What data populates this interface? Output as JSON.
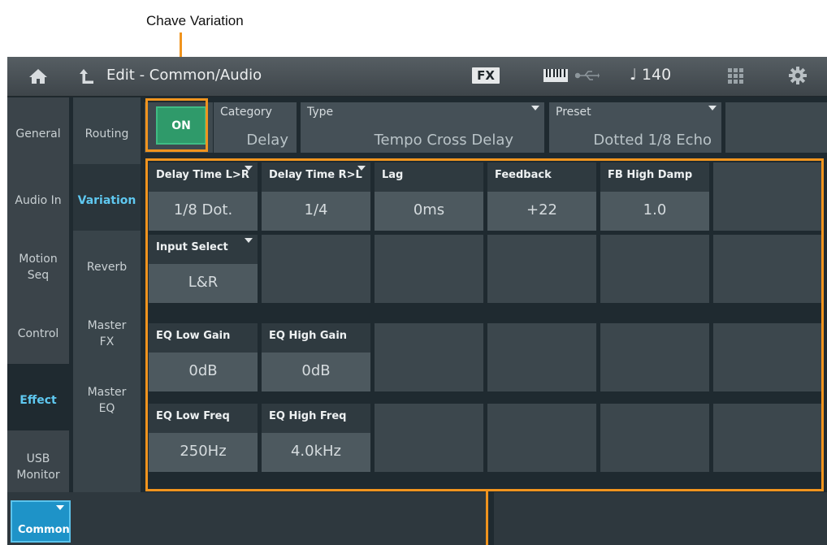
{
  "callout": {
    "label": "Chave Variation"
  },
  "topbar": {
    "title": "Edit - Common/Audio",
    "fx_label": "FX",
    "tempo": "140",
    "tempo_note": "♩",
    "icons": [
      "home-icon",
      "back-icon",
      "fx-icon",
      "keyboard-icon",
      "usb-icon",
      "grid-icon",
      "gear-icon"
    ]
  },
  "left_tabs": [
    {
      "label": "General",
      "active": false
    },
    {
      "label": "Audio In",
      "active": false
    },
    {
      "label": "Motion\nSeq",
      "active": false
    },
    {
      "label": "Control",
      "active": false
    },
    {
      "label": "Effect",
      "active": true
    },
    {
      "label": "USB\nMonitor",
      "active": false
    }
  ],
  "sub_tabs": [
    {
      "label": "Routing",
      "selected": false
    },
    {
      "label": "Variation",
      "selected": true
    },
    {
      "label": "Reverb",
      "selected": false
    },
    {
      "label": "Master\nFX",
      "selected": false
    },
    {
      "label": "Master\nEQ",
      "selected": false
    },
    {
      "label": "",
      "selected": false
    }
  ],
  "effect_header": {
    "switch": "ON",
    "category_label": "Category",
    "category_value": "Delay",
    "type_label": "Type",
    "type_value": "Tempo Cross Delay",
    "preset_label": "Preset",
    "preset_value": "Dotted 1/8 Echo"
  },
  "params": [
    {
      "label": "Delay Time L>R",
      "value": "1/8 Dot.",
      "dropdown": true
    },
    {
      "label": "Delay Time R>L",
      "value": "1/4",
      "dropdown": true
    },
    {
      "label": "Lag",
      "value": "0ms",
      "dropdown": false
    },
    {
      "label": "Feedback",
      "value": "+22",
      "dropdown": false
    },
    {
      "label": "FB High Damp",
      "value": "1.0",
      "dropdown": false
    },
    {
      "label": "Input Select",
      "value": "L&R",
      "dropdown": true
    },
    {
      "label": "EQ Low Gain",
      "value": "0dB",
      "dropdown": false
    },
    {
      "label": "EQ High Gain",
      "value": "0dB",
      "dropdown": false
    },
    {
      "label": "EQ Low Freq",
      "value": "250Hz",
      "dropdown": false
    },
    {
      "label": "EQ High Freq",
      "value": "4.0kHz",
      "dropdown": false
    }
  ],
  "common_button": {
    "label": "Common"
  },
  "colors": {
    "accent": "#5fc8f0",
    "on_green": "#2f9a6a",
    "highlight_orange": "#f0941e"
  }
}
